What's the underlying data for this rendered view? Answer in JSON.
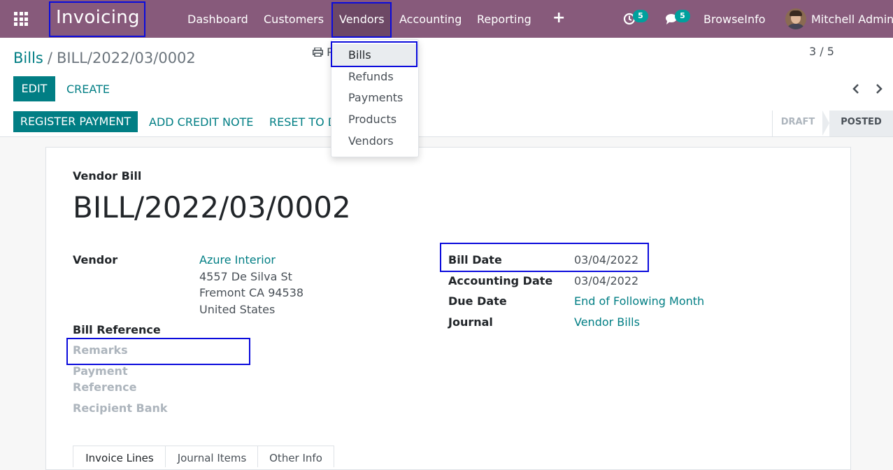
{
  "navbar": {
    "app_name": "Invoicing",
    "menus": [
      "Dashboard",
      "Customers",
      "Vendors",
      "Accounting",
      "Reporting"
    ],
    "activity_count": "5",
    "message_count": "5",
    "company": "BrowseInfo",
    "user": "Mitchell Admin",
    "icons": [
      "apps-grid-icon",
      "plus-icon",
      "clock-icon",
      "chat-icon",
      "avatar"
    ]
  },
  "vendors_menu": {
    "items": [
      "Bills",
      "Refunds",
      "Payments",
      "Products",
      "Vendors"
    ]
  },
  "breadcrumb": {
    "parent": "Bills",
    "separator": "/",
    "current": "BILL/2022/03/0002"
  },
  "actions": {
    "edit": "EDIT",
    "create": "CREATE",
    "print": "P"
  },
  "pager": {
    "value": "3 / 5"
  },
  "statusbar": {
    "register_payment": "REGISTER PAYMENT",
    "add_credit_note": "ADD CREDIT NOTE",
    "reset_to_draft": "RESET TO D",
    "states": [
      "DRAFT",
      "POSTED"
    ],
    "active_state": "POSTED"
  },
  "form": {
    "kind": "Vendor Bill",
    "name": "BILL/2022/03/0002",
    "left_fields": {
      "vendor_label": "Vendor",
      "vendor_name": "Azure Interior",
      "vendor_address": [
        "4557 De Silva St",
        "Fremont CA 94538",
        "United States"
      ],
      "bill_reference_label": "Bill Reference",
      "remarks_label": "Remarks",
      "payment_reference_label_1": "Payment",
      "payment_reference_label_2": "Reference",
      "recipient_bank_label": "Recipient Bank"
    },
    "right_fields": {
      "bill_date_label": "Bill Date",
      "bill_date": "03/04/2022",
      "accounting_date_label": "Accounting Date",
      "accounting_date": "03/04/2022",
      "due_date_label": "Due Date",
      "due_date": "End of Following Month",
      "journal_label": "Journal",
      "journal": "Vendor Bills"
    },
    "tabs": [
      "Invoice Lines",
      "Journal Items",
      "Other Info"
    ]
  },
  "colors": {
    "navbar": "#875a7b",
    "primary": "#017e84",
    "badge": "#00a09d",
    "highlight": "#0b0bdc"
  }
}
